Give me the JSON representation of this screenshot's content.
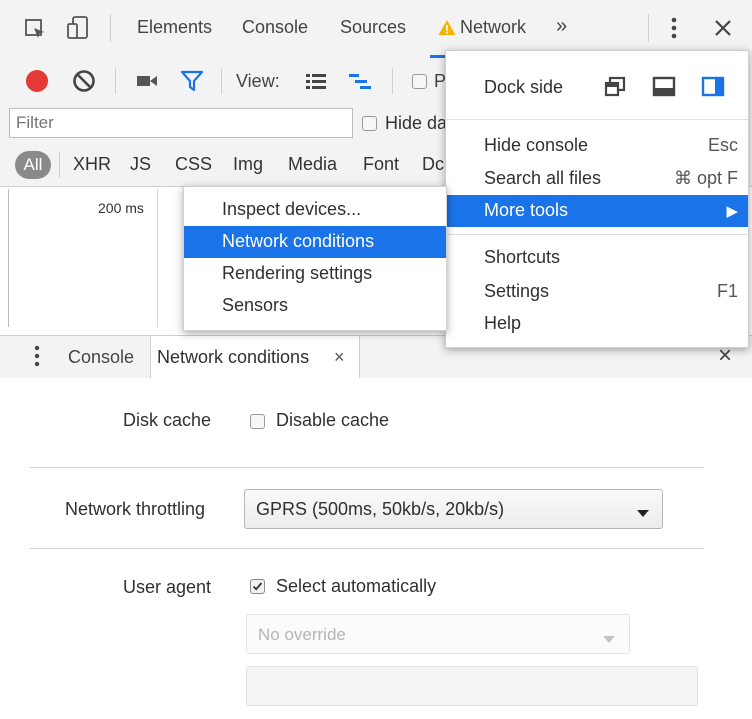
{
  "tabbar": {
    "tabs": [
      "Elements",
      "Console",
      "Sources",
      "Network"
    ],
    "more_label": "»",
    "active_tab_color": "#1a73e8",
    "warning_color": "#f4b400"
  },
  "toolbar": {
    "record_color": "#e53935",
    "view_label": "View:",
    "preserve_initial": "P"
  },
  "filter": {
    "placeholder": "Filter",
    "hide_label": "Hide da"
  },
  "types": [
    "All",
    "XHR",
    "JS",
    "CSS",
    "Img",
    "Media",
    "Font",
    "Dc"
  ],
  "timeline": {
    "tick": "200 ms"
  },
  "main_menu": {
    "dock_side_label": "Dock side",
    "items": [
      {
        "label": "Hide console",
        "shortcut": "Esc"
      },
      {
        "label": "Search all files",
        "shortcut": "⌘ opt F"
      },
      {
        "label": "More tools",
        "arrow": "▶"
      },
      {
        "label": "Shortcuts"
      },
      {
        "label": "Settings",
        "shortcut": "F1"
      },
      {
        "label": "Help"
      }
    ]
  },
  "more_tools_menu": {
    "items": [
      "Inspect devices...",
      "Network conditions",
      "Rendering settings",
      "Sensors"
    ]
  },
  "drawer": {
    "tabs": [
      "Console",
      "Network conditions"
    ],
    "close_tab": "×",
    "close_drawer": "×"
  },
  "conditions": {
    "disk_cache_label": "Disk cache",
    "disable_cache_label": "Disable cache",
    "throttling_label": "Network throttling",
    "throttling_value": "GPRS (500ms, 50kb/s, 20kb/s)",
    "user_agent_label": "User agent",
    "select_auto_label": "Select automatically",
    "ua_select_value": "No override"
  }
}
